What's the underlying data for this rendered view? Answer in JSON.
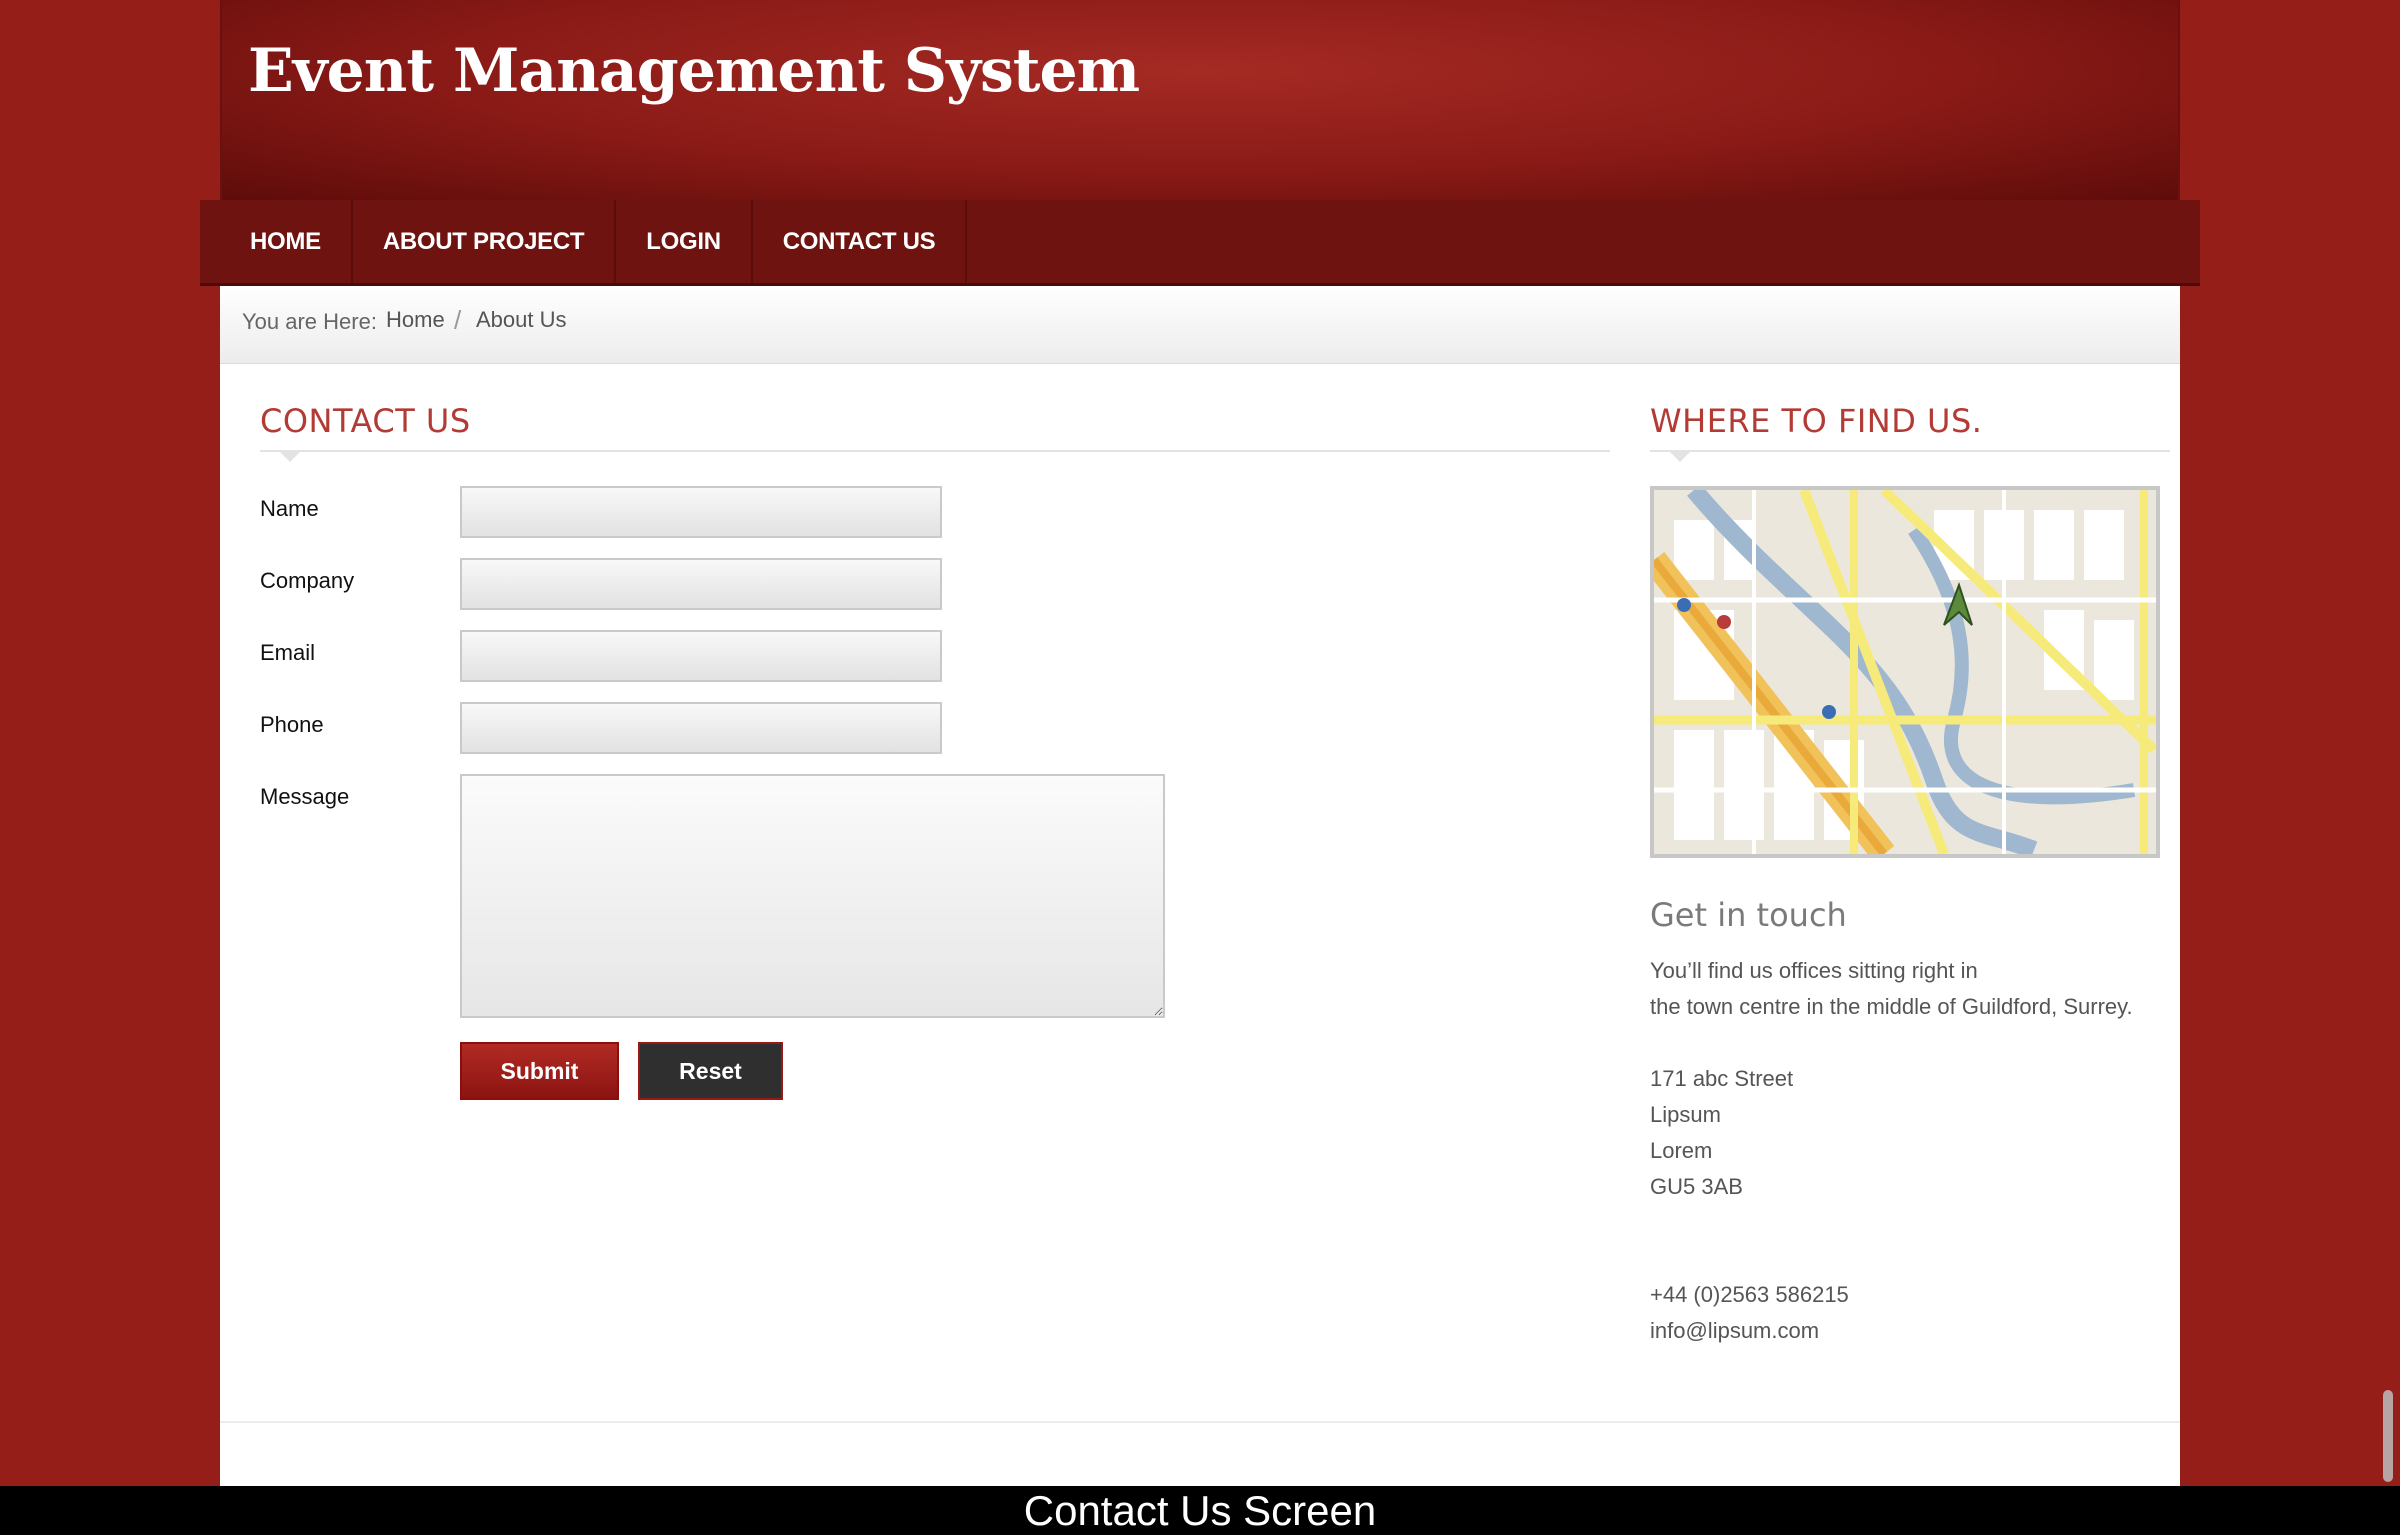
{
  "header": {
    "title": "Event Management System"
  },
  "nav": {
    "items": [
      {
        "label": "HOME"
      },
      {
        "label": "ABOUT PROJECT"
      },
      {
        "label": "LOGIN"
      },
      {
        "label": "CONTACT US"
      }
    ]
  },
  "breadcrumb": {
    "prefix": "You are Here:",
    "home": "Home",
    "separator": "/",
    "current": "About Us"
  },
  "contact_form": {
    "heading": "CONTACT US",
    "fields": {
      "name": {
        "label": "Name",
        "value": ""
      },
      "company": {
        "label": "Company",
        "value": ""
      },
      "email": {
        "label": "Email",
        "value": ""
      },
      "phone": {
        "label": "Phone",
        "value": ""
      },
      "message": {
        "label": "Message",
        "value": ""
      }
    },
    "submit_label": "Submit",
    "reset_label": "Reset"
  },
  "sidebar": {
    "heading": "WHERE TO FIND US.",
    "get_in_touch": "Get in touch",
    "intro_line1": "You’ll find us offices sitting right in",
    "intro_line2": "the town centre in the middle of Guildford, Surrey.",
    "address": [
      "171 abc Street",
      "Lipsum",
      "Lorem",
      "GU5 3AB"
    ],
    "phone": "+44 (0)2563 586215",
    "email": "info@lipsum.com"
  },
  "caption": "Contact Us Screen",
  "colors": {
    "brand_red": "#961e19",
    "nav_dark": "#6e1310",
    "heading_red": "#b33b36"
  }
}
